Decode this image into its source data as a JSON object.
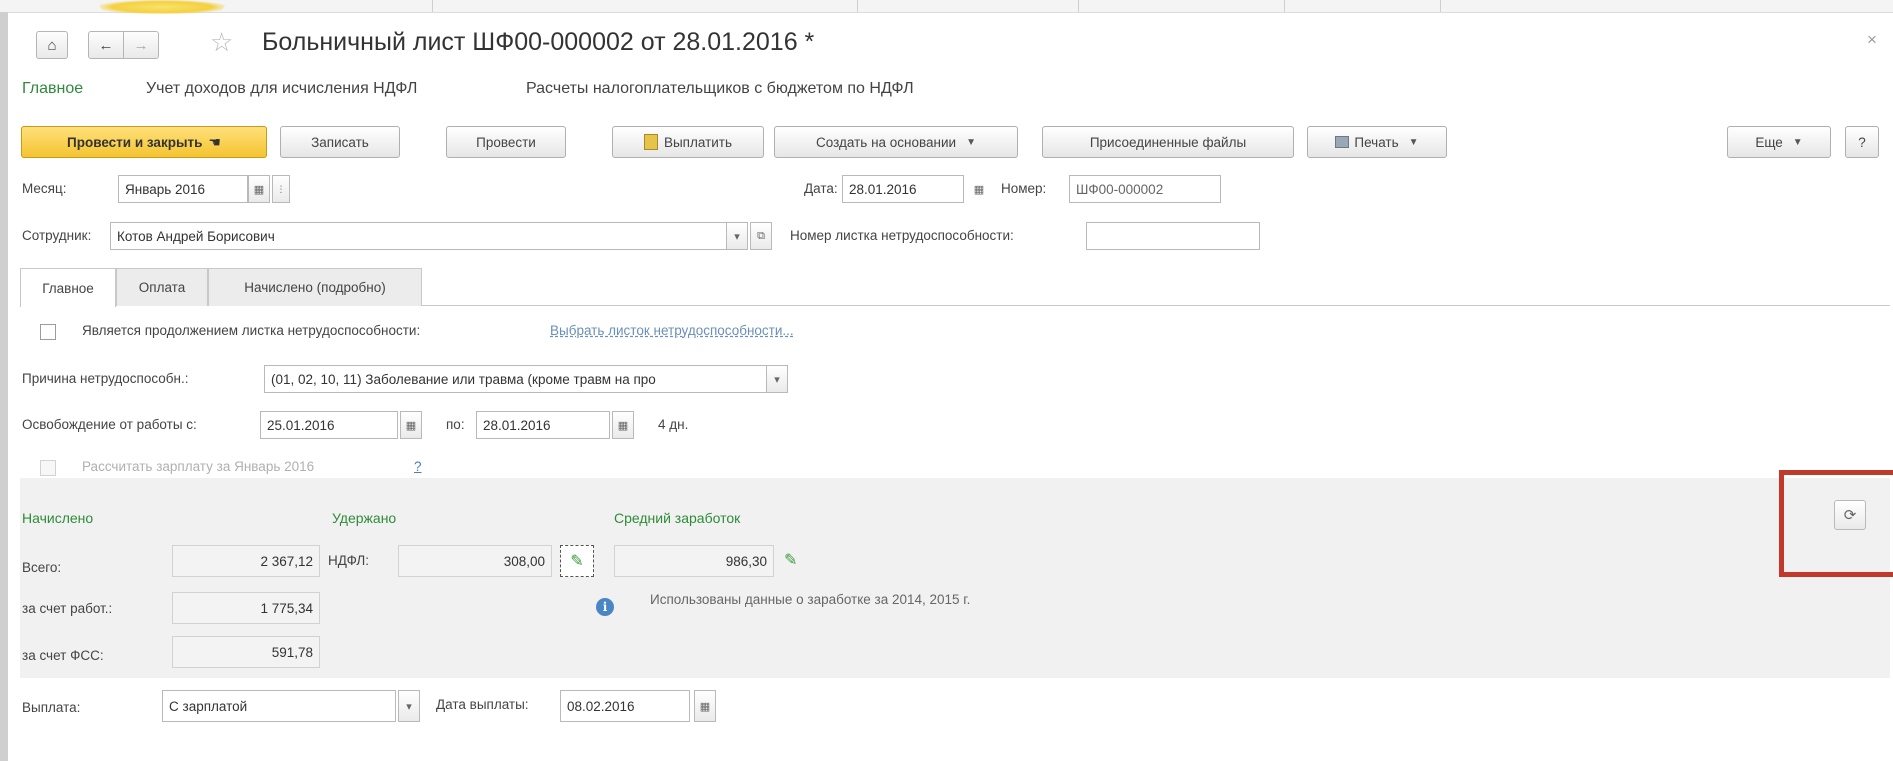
{
  "window": {
    "title": "Больничный лист ШФ00-000002 от 28.01.2016 *",
    "close_glyph": "×",
    "home_glyph": "⌂",
    "back_glyph": "←",
    "forward_glyph": "→",
    "star_glyph": "☆"
  },
  "subnav": {
    "items": [
      "Главное",
      "Учет доходов для исчисления НДФЛ",
      "Расчеты налогоплательщиков с бюджетом по НДФЛ"
    ]
  },
  "toolbar": {
    "post_close": "Провести и закрыть",
    "save": "Записать",
    "post": "Провести",
    "pay": "Выплатить",
    "create_based": "Создать на основании",
    "attached_files": "Присоединенные файлы",
    "print": "Печать",
    "more": "Еще",
    "help": "?",
    "caret": "▼"
  },
  "header": {
    "month_label": "Месяц:",
    "month_value": "Январь 2016",
    "date_label": "Дата:",
    "date_value": "28.01.2016",
    "number_label": "Номер:",
    "number_value": "ШФ00-000002",
    "employee_label": "Сотрудник:",
    "employee_value": "Котов Андрей Борисович",
    "sheet_number_label": "Номер листка нетрудоспособности:",
    "sheet_number_value": ""
  },
  "tabs": [
    {
      "label": "Главное"
    },
    {
      "label": "Оплата"
    },
    {
      "label": "Начислено (подробно)"
    }
  ],
  "main": {
    "continuation_label": "Является продолжением листка нетрудоспособности:",
    "continuation_link": "Выбрать листок нетрудоспособности...",
    "reason_label": "Причина нетрудоспособн.:",
    "reason_value": "(01, 02, 10, 11) Заболевание или травма (кроме травм на про",
    "release_label": "Освобождение от работы с:",
    "release_from": "25.01.2016",
    "release_to_label": "по:",
    "release_to": "28.01.2016",
    "days": "4 дн.",
    "calc_salary_label": "Рассчитать зарплату за Январь 2016",
    "help_mark": "?"
  },
  "amounts": {
    "accrued_heading": "Начислено",
    "withheld_heading": "Удержано",
    "avg_heading": "Средний заработок",
    "total_label": "Всего:",
    "total_value": "2 367,12",
    "ndfl_label": "НДФЛ:",
    "ndfl_value": "308,00",
    "avg_value": "986,30",
    "employer_label": "за счет работ.:",
    "employer_value": "1 775,34",
    "fss_label": "за счет ФСС:",
    "fss_value": "591,78",
    "info_text": "Использованы данные о заработке за  2014,  2015 г."
  },
  "payment": {
    "label": "Выплата:",
    "value": "С зарплатой",
    "date_label": "Дата выплаты:",
    "date_value": "08.02.2016"
  },
  "colors": {
    "accent_green": "#2f8b3a",
    "primary_button": "#f4c430",
    "highlight_frame": "#c0392b",
    "link": "#6a8fb8"
  }
}
